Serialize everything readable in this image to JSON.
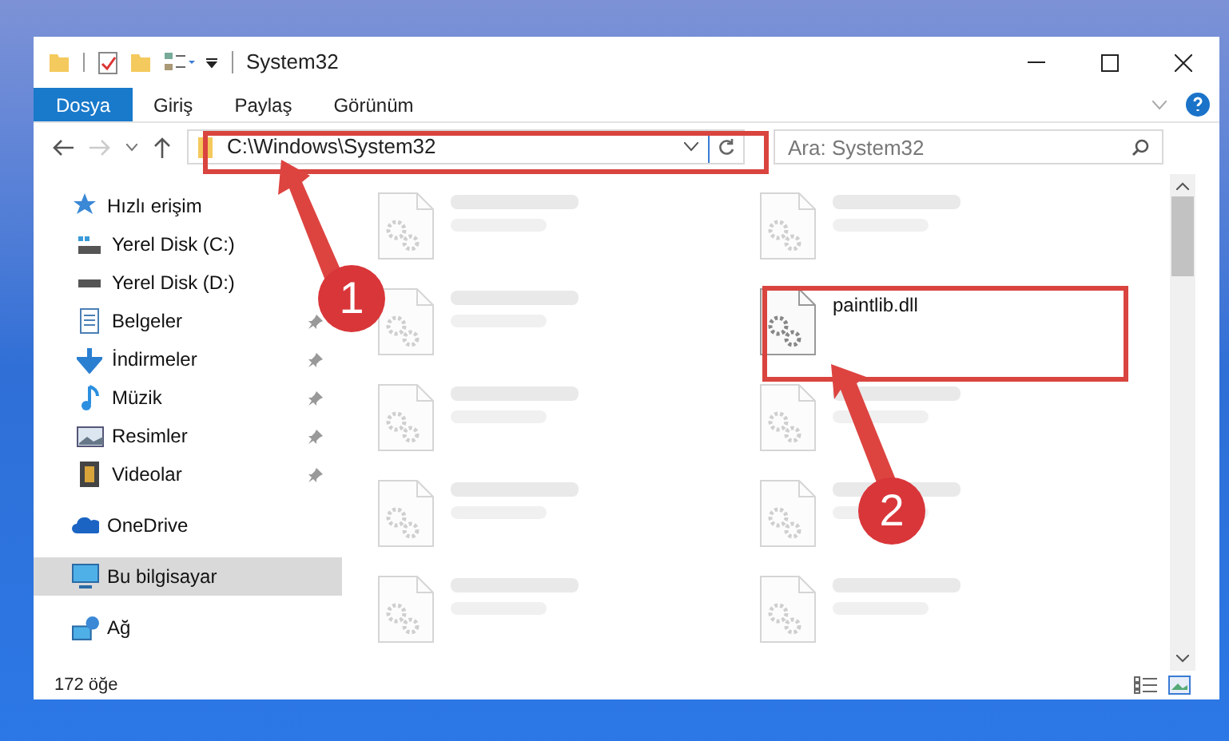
{
  "window": {
    "title": "System32"
  },
  "ribbon_tabs": [
    {
      "label": "Dosya",
      "selected": true
    },
    {
      "label": "Giriş",
      "selected": false
    },
    {
      "label": "Paylaş",
      "selected": false
    },
    {
      "label": "Görünüm",
      "selected": false
    }
  ],
  "address_bar": {
    "path": "C:\\Windows\\System32"
  },
  "search": {
    "placeholder": "Ara: System32"
  },
  "sidebar": {
    "items": [
      {
        "label": "Hızlı erişim",
        "kind": "star",
        "selected": false,
        "children": [
          {
            "label": "Yerel Disk (C:)",
            "kind": "systemdrive"
          },
          {
            "label": "Yerel Disk (D:)",
            "kind": "drive"
          },
          {
            "label": "Belgeler",
            "kind": "document",
            "pinned": true
          },
          {
            "label": "İndirmeler",
            "kind": "download",
            "pinned": true
          },
          {
            "label": "Müzik",
            "kind": "music",
            "pinned": true
          },
          {
            "label": "Resimler",
            "kind": "image",
            "pinned": true
          },
          {
            "label": "Videolar",
            "kind": "video",
            "pinned": true
          }
        ]
      },
      {
        "label": "OneDrive",
        "kind": "cloud",
        "selected": false
      },
      {
        "label": "Bu bilgisayar",
        "kind": "computer",
        "selected": true
      },
      {
        "label": "Ağ",
        "kind": "network",
        "selected": false
      }
    ]
  },
  "files": [
    {
      "kind": "blurred"
    },
    {
      "kind": "blurred"
    },
    {
      "kind": "blurred"
    },
    {
      "kind": "file",
      "name": "paintlib.dll"
    },
    {
      "kind": "blurred"
    },
    {
      "kind": "blurred"
    },
    {
      "kind": "blurred"
    },
    {
      "kind": "blurred"
    },
    {
      "kind": "blurred"
    },
    {
      "kind": "blurred"
    }
  ],
  "status_bar": {
    "count": "172 öğe"
  },
  "callouts": [
    {
      "label": "1"
    },
    {
      "label": "2"
    }
  ]
}
